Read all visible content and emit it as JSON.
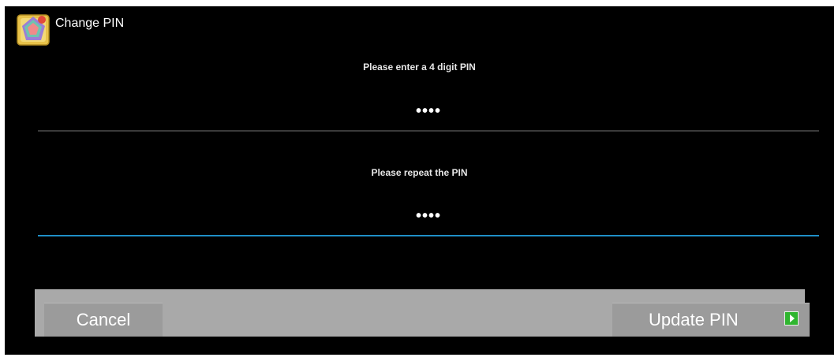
{
  "dialog": {
    "title": "Change PIN",
    "app_icon": "app-icon"
  },
  "pin_entry": {
    "prompt": "Please enter a 4 digit PIN",
    "masked_value": "••••"
  },
  "pin_repeat": {
    "prompt": "Please repeat the PIN",
    "masked_value": "••••"
  },
  "buttons": {
    "cancel_label": "Cancel",
    "update_label": "Update PIN",
    "update_icon": "go-arrow-icon"
  },
  "colors": {
    "background": "#000000",
    "focus_underline": "#1f8fc7",
    "button_bar": "#a9a9a9",
    "go_icon": "#2fb52f"
  }
}
